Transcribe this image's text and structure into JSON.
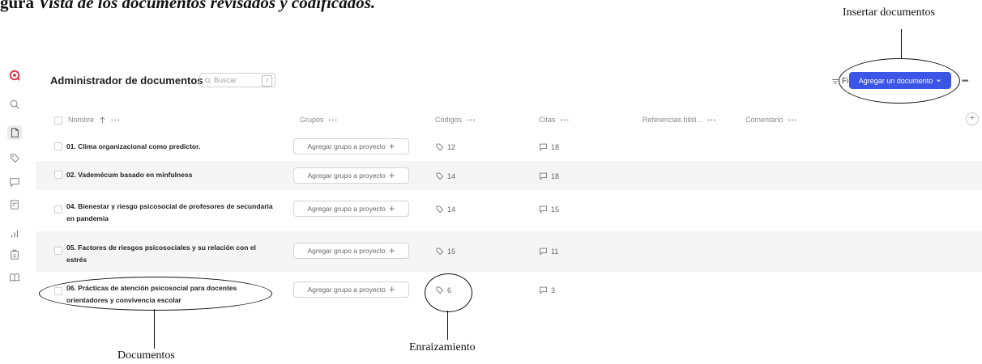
{
  "caption": {
    "lead": "gura",
    "text": "Vista de los documentos revisados y codificados."
  },
  "annotations": {
    "insert": "Insertar documentos",
    "documents": "Documentos",
    "rooting": "Enraizamiento"
  },
  "header": {
    "title": "Administrador de documentos",
    "search_placeholder": "Buscar",
    "search_shortcut": "/",
    "filter_label": "Filtro",
    "add_button": "Agregar un documento",
    "more": "•••"
  },
  "sidebar": {
    "icons": [
      "logo-icon",
      "search-icon",
      "document-icon",
      "tag-icon",
      "comment-icon",
      "memo-icon",
      "chart-icon",
      "report-icon",
      "book-icon"
    ]
  },
  "columns": {
    "name": "Nombre",
    "groups": "Grupos",
    "codes": "Códigos",
    "quotes": "Citas",
    "references": "Referencias bibli...",
    "comment": "Comentario",
    "dots": "•••"
  },
  "rows": [
    {
      "name": "01. Clima organizacional como predictor.",
      "group_button": "Agregar grupo a proyecto",
      "codes": "12",
      "quotes": "18"
    },
    {
      "name": "02. Vademécum basado en minfulness",
      "group_button": "Agregar grupo a proyecto",
      "codes": "14",
      "quotes": "18"
    },
    {
      "name": "04. Bienestar y riesgo psicosocial de profesores de secundaria en pandemia",
      "group_button": "Agregar grupo a proyecto",
      "codes": "14",
      "quotes": "15"
    },
    {
      "name": "05. Factores de riesgos psicosociales y su relación con el estrés",
      "group_button": "Agregar grupo a proyecto",
      "codes": "15",
      "quotes": "11"
    },
    {
      "name": "06. Prácticas de atención psicosocial para docentes orientadores y convivencia escolar",
      "group_button": "Agregar grupo a proyecto",
      "codes": "6",
      "quotes": "3"
    }
  ],
  "colors": {
    "accent": "#3b55e6",
    "logo": "#e5344a"
  }
}
